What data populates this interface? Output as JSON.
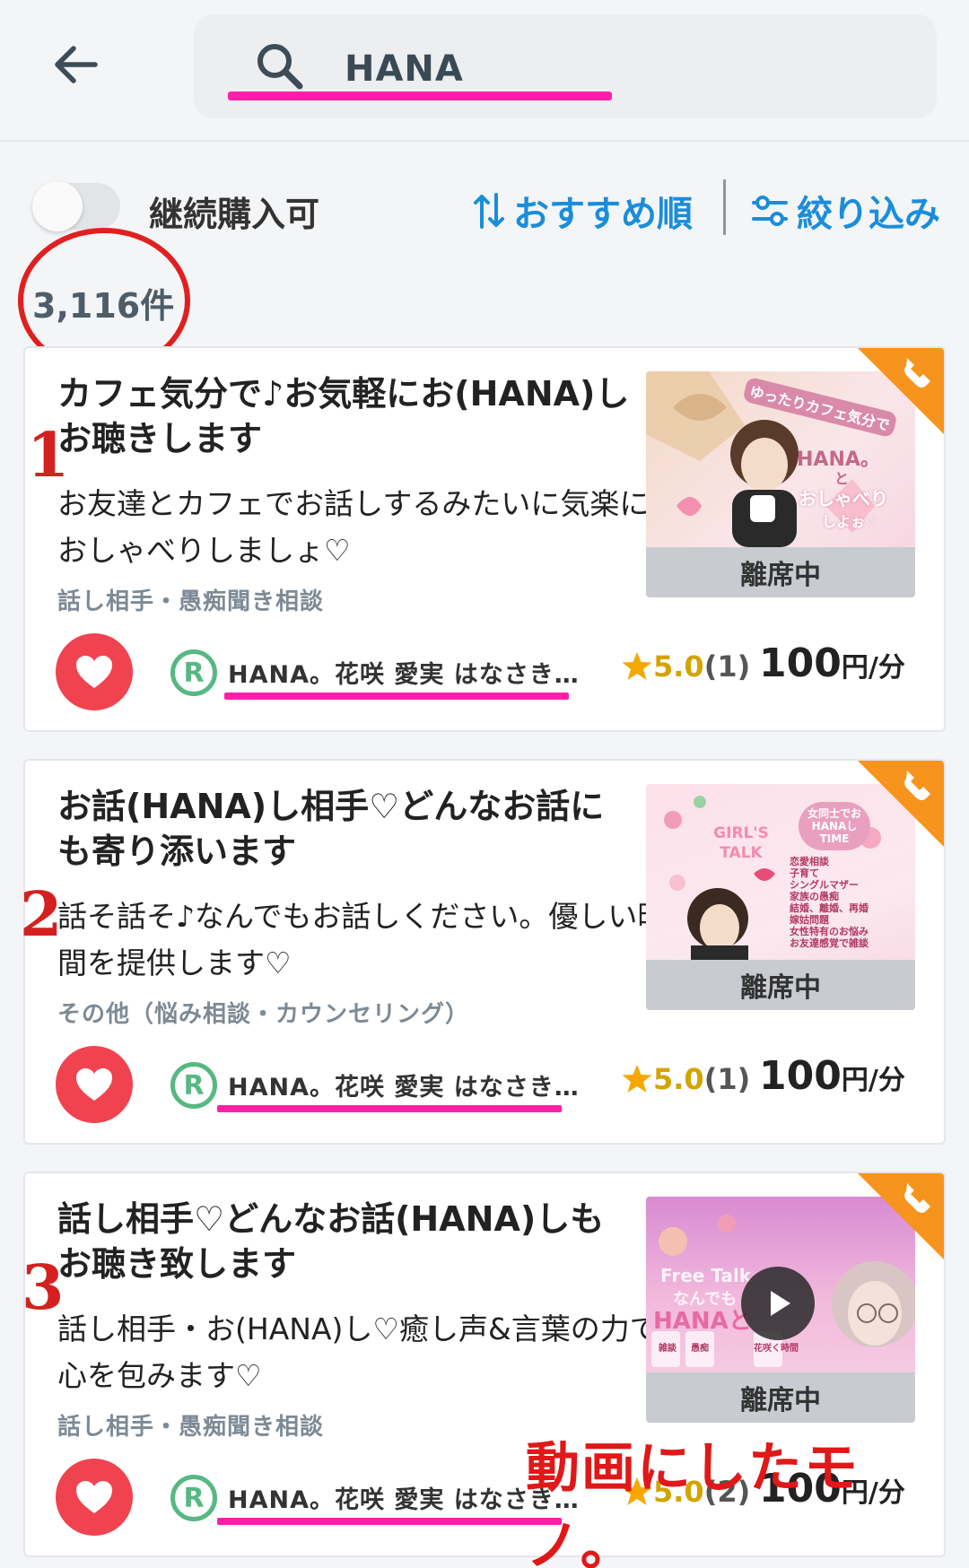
{
  "search": {
    "query": "HANA"
  },
  "filters": {
    "toggle_label": "継続購入可",
    "sort_label": "おすすめ順",
    "filter_label": "絞り込み"
  },
  "result_count": "3,116件",
  "listings": [
    {
      "title": "カフェ気分で♪お気軽にお(HANA)しお聴きします",
      "description": "お友達とカフェでお話しするみたいに気楽におしゃべりしましょ♡",
      "category": "話し相手・愚痴聞き相談",
      "status": "離席中",
      "seller": "HANA。花咲 愛実 はなさき…",
      "rating": "5.0",
      "rating_count": "(1)",
      "price": "100",
      "price_unit": "円/分",
      "annotation": "1",
      "thumbnail_text": [
        "ゆったりカフェ気分で",
        "HANA。",
        "と",
        "おしゃべり",
        "しよぉ♡"
      ]
    },
    {
      "title": "お話(HANA)し相手♡どんなお話にも寄り添います",
      "description": "話そ話そ♪なんでもお話しください。優しい時間を提供します♡",
      "category": "その他（悩み相談・カウンセリング）",
      "status": "離席中",
      "seller": "HANA。花咲 愛実 はなさき…",
      "rating": "5.0",
      "rating_count": "(1)",
      "price": "100",
      "price_unit": "円/分",
      "annotation": "2",
      "thumbnail_text": [
        "GIRL'S TALK",
        "女同士でおHANAしTIME",
        "恋愛相談",
        "子育て",
        "シングルマザー",
        "家族の愚痴",
        "結婚、離婚、再婚",
        "嫁姑問題",
        "女性特有のお悩み",
        "お友達感覚で雑談"
      ]
    },
    {
      "title": "話し相手♡どんなお話(HANA)しもお聴き致します",
      "description": "話し相手・お(HANA)し♡癒し声&言葉の力で心を包みます♡",
      "category": "話し相手・愚痴聞き相談",
      "status": "離席中",
      "seller": "HANA。花咲 愛実 はなさき…",
      "rating": "5.0",
      "rating_count": "(2)",
      "price": "100",
      "price_unit": "円/分",
      "annotation": "3",
      "thumbnail_text": [
        "Free Talk",
        "なんでも",
        "HANAと",
        "雑談",
        "愚痴",
        "花咲く時間"
      ]
    }
  ],
  "video_caption": "動画にしたモノ。",
  "colors": {
    "accent_blue": "#1a8ddb",
    "highlight_pink": "#ff1fa8",
    "annotation_red": "#e02020",
    "like_red": "#f0434f",
    "badge_orange": "#f7941d",
    "r_green": "#57b882"
  }
}
